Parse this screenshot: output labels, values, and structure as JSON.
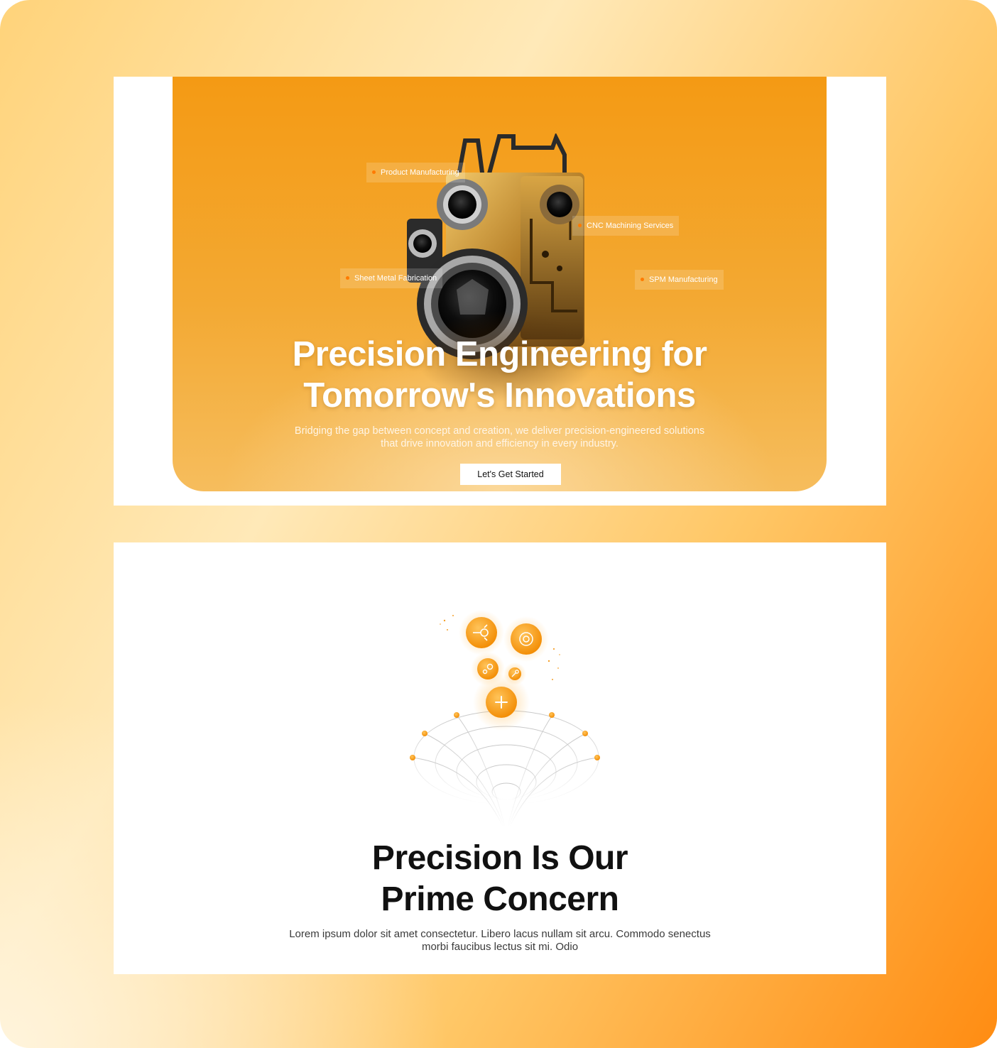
{
  "hero": {
    "tags": {
      "product": "Product Manufacturing",
      "cnc": "CNC Machining Services",
      "sheet": "Sheet Metal Fabrication",
      "spm": "SPM Manufacturing"
    },
    "title_line1": "Precision Engineering for",
    "title_line2": "Tomorrow's Innovations",
    "subtitle_line1": "Bridging the gap between concept and creation, we deliver precision-engineered solutions",
    "subtitle_line2": "that drive innovation and efficiency in every industry.",
    "cta_label": "Let's Get Started"
  },
  "feature": {
    "title_line1": "Precision Is Our",
    "title_line2": "Prime Concern",
    "subtitle_line1": "Lorem ipsum dolor sit amet consectetur. Libero lacus nullam sit arcu. Commodo senectus",
    "subtitle_line2": "morbi faucibus lectus sit mi. Odio",
    "icons": [
      "drill-icon",
      "target-icon",
      "gears-icon",
      "wrench-icon",
      "plus-icon"
    ]
  },
  "colors": {
    "accent": "#f39a12",
    "accent_light": "#ffb43a",
    "title_dark": "#111111"
  }
}
